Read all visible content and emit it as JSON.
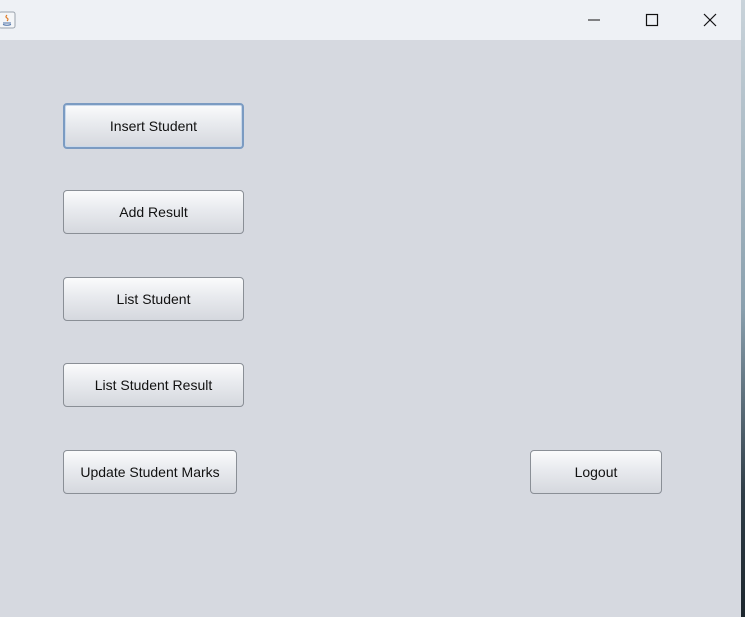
{
  "window": {
    "title": "",
    "controls": {
      "minimize": "minimize-icon",
      "maximize": "maximize-icon",
      "close": "close-icon"
    }
  },
  "buttons": {
    "insert_student": "Insert Student",
    "add_result": "Add Result",
    "list_student": "List Student",
    "list_student_result": "List Student Result",
    "update_student_marks": "Update Student Marks",
    "logout": "Logout"
  },
  "colors": {
    "background": "#d6d9e0",
    "titlebar": "#eef1f5",
    "focus_border": "#7b9bc2"
  }
}
